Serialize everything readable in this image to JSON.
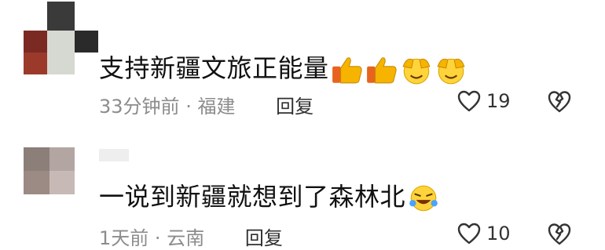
{
  "comments": [
    {
      "text": "支持新疆文旅正能量",
      "emojis": [
        "thumbs-up-icon",
        "thumbs-up-icon",
        "clapping-hands-icon",
        "clapping-hands-icon"
      ],
      "time": "33分钟前",
      "separator": "·",
      "location": "福建",
      "reply_label": "回复",
      "likes": "19"
    },
    {
      "text": "一说到新疆就想到了森林北",
      "emojis": [
        "laughing-crying-icon"
      ],
      "time": "1天前",
      "separator": "·",
      "location": "云南",
      "reply_label": "回复",
      "likes": "10"
    }
  ],
  "colors": {
    "text": "#111111",
    "meta": "#8c8c8c",
    "emoji_yellow": "#f6b400",
    "emoji_orange": "#e8631f"
  }
}
